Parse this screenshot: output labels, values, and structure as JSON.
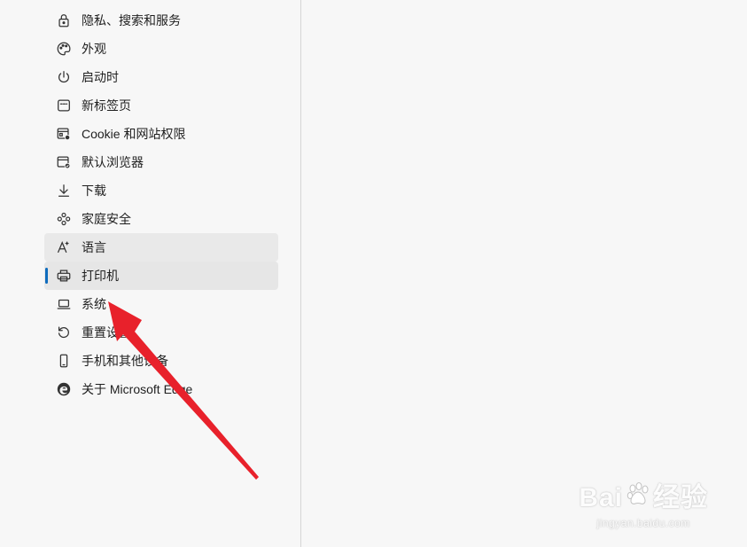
{
  "sidebar": {
    "items": [
      {
        "label": "隐私、搜索和服务",
        "icon": "lock-icon",
        "state": "normal"
      },
      {
        "label": "外观",
        "icon": "palette-icon",
        "state": "normal"
      },
      {
        "label": "启动时",
        "icon": "power-icon",
        "state": "normal"
      },
      {
        "label": "新标签页",
        "icon": "new-tab-icon",
        "state": "normal"
      },
      {
        "label": "Cookie 和网站权限",
        "icon": "site-permissions-icon",
        "state": "normal"
      },
      {
        "label": "默认浏览器",
        "icon": "default-browser-icon",
        "state": "normal"
      },
      {
        "label": "下载",
        "icon": "download-icon",
        "state": "normal"
      },
      {
        "label": "家庭安全",
        "icon": "family-icon",
        "state": "normal"
      },
      {
        "label": "语言",
        "icon": "language-icon",
        "state": "hover"
      },
      {
        "label": "打印机",
        "icon": "printer-icon",
        "state": "selected"
      },
      {
        "label": "系统",
        "icon": "laptop-icon",
        "state": "normal"
      },
      {
        "label": "重置设置",
        "icon": "reset-icon",
        "state": "normal"
      },
      {
        "label": "手机和其他设备",
        "icon": "phone-icon",
        "state": "normal"
      },
      {
        "label": "关于 Microsoft Edge",
        "icon": "edge-logo-icon",
        "state": "normal"
      }
    ]
  },
  "colors": {
    "background": "#f7f7f7",
    "selected_indicator": "#0f6cbd",
    "annotation_arrow": "#e8212b"
  },
  "watermark": {
    "logo_text_left": "Bai",
    "logo_text_right": "经验",
    "url": "jingyan.baidu.com"
  }
}
